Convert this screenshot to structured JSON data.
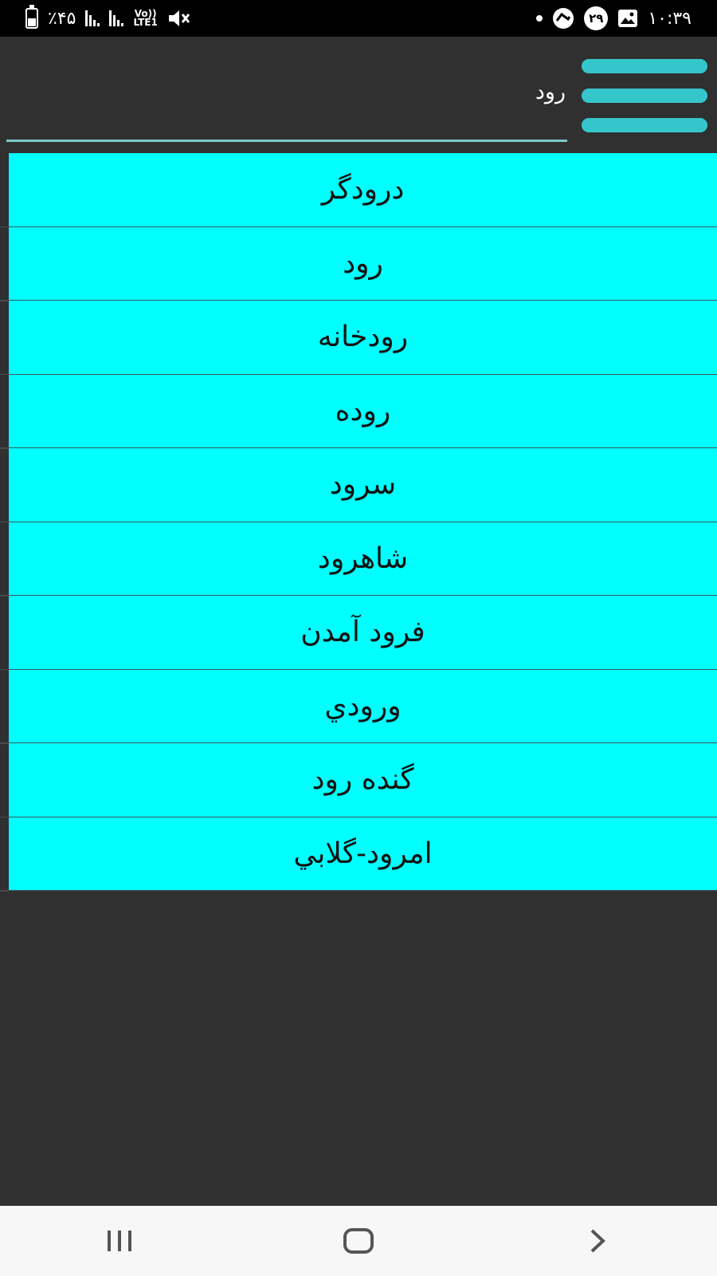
{
  "status_bar": {
    "battery_text": "٪۴۵",
    "network_top": "Vo))",
    "network_bottom": "LTE1",
    "notification_count": "۲۹",
    "time": "۱۰:۳۹",
    "battery_level": 0.45
  },
  "search": {
    "value": "رود"
  },
  "results": [
    {
      "label": "درودگر"
    },
    {
      "label": "رود"
    },
    {
      "label": "رودخانه"
    },
    {
      "label": "روده"
    },
    {
      "label": "سرود"
    },
    {
      "label": "شاهرود"
    },
    {
      "label": "فرود آمدن"
    },
    {
      "label": "ورودي"
    },
    {
      "label": "گنده رود"
    },
    {
      "label": "امرود-گلابي"
    }
  ],
  "colors": {
    "accent": "#35c6cc",
    "list_background": "#00ffff",
    "app_background": "#303030"
  },
  "icons": {
    "menu": "hamburger-icon",
    "nav_recent": "recent-apps-icon",
    "nav_home": "home-icon",
    "nav_back": "back-icon"
  }
}
